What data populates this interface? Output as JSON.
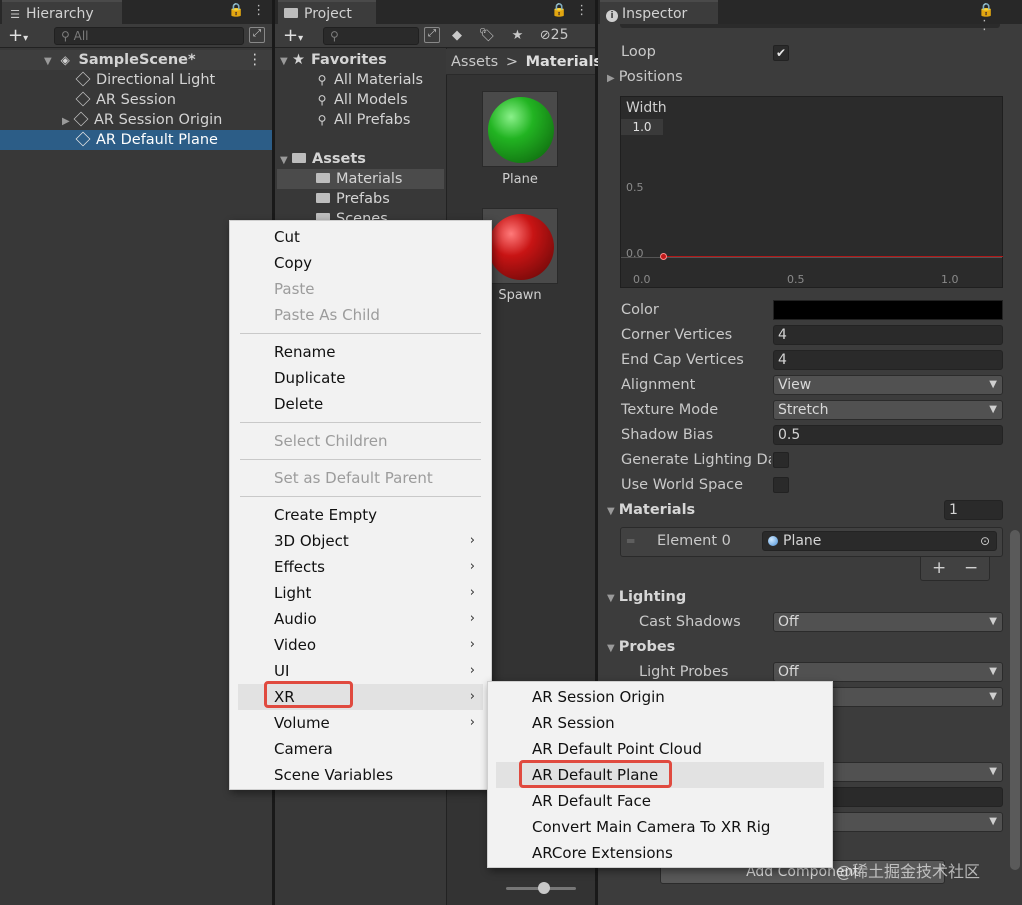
{
  "hierarchy": {
    "tab_title": "Hierarchy",
    "search_placeholder": "All",
    "scene_name": "SampleScene*",
    "items": [
      "Directional Light",
      "AR Session",
      "AR Session Origin",
      "AR Default Plane"
    ],
    "selected_index": 3
  },
  "project": {
    "tab_title": "Project",
    "badge_count": "25",
    "favorites_label": "Favorites",
    "favorites": [
      "All Materials",
      "All Models",
      "All Prefabs"
    ],
    "assets_label": "Assets",
    "folders": [
      "Materials",
      "Prefabs",
      "Scenes"
    ],
    "breadcrumb_root": "Assets",
    "breadcrumb_sep": ">",
    "breadcrumb_current": "Materials",
    "thumbs": [
      {
        "label": "Plane",
        "color": "#22b422"
      },
      {
        "label": "Spawn",
        "color": "#c81414"
      }
    ]
  },
  "inspector": {
    "tab_title": "Inspector",
    "loop_label": "Loop",
    "positions_label": "Positions",
    "width_label": "Width",
    "width_value": "1.0",
    "curve_y_ticks": [
      "0.5",
      "0.0"
    ],
    "curve_x_ticks": [
      "0.0",
      "0.5",
      "1.0"
    ],
    "props": [
      {
        "label": "Color",
        "kind": "color",
        "value": ""
      },
      {
        "label": "Corner Vertices",
        "kind": "field",
        "value": "4"
      },
      {
        "label": "End Cap Vertices",
        "kind": "field",
        "value": "4"
      },
      {
        "label": "Alignment",
        "kind": "dropdown",
        "value": "View"
      },
      {
        "label": "Texture Mode",
        "kind": "dropdown",
        "value": "Stretch"
      },
      {
        "label": "Shadow Bias",
        "kind": "field",
        "value": "0.5"
      },
      {
        "label": "Generate Lighting Da",
        "kind": "checkbox",
        "value": ""
      },
      {
        "label": "Use World Space",
        "kind": "checkbox",
        "value": ""
      }
    ],
    "materials_label": "Materials",
    "materials_count": "1",
    "element0_label": "Element 0",
    "element0_value": "Plane",
    "lighting_label": "Lighting",
    "cast_shadows_label": "Cast Shadows",
    "cast_shadows_value": "Off",
    "probes_label": "Probes",
    "light_probes_label": "Light Probes",
    "light_probes_value": "Off",
    "add_component": "Add Component"
  },
  "context_menu": {
    "groups": [
      [
        {
          "label": "Cut",
          "enabled": true
        },
        {
          "label": "Copy",
          "enabled": true
        },
        {
          "label": "Paste",
          "enabled": false
        },
        {
          "label": "Paste As Child",
          "enabled": false
        }
      ],
      [
        {
          "label": "Rename",
          "enabled": true
        },
        {
          "label": "Duplicate",
          "enabled": true
        },
        {
          "label": "Delete",
          "enabled": true
        }
      ],
      [
        {
          "label": "Select Children",
          "enabled": false
        }
      ],
      [
        {
          "label": "Set as Default Parent",
          "enabled": false
        }
      ],
      [
        {
          "label": "Create Empty",
          "enabled": true
        },
        {
          "label": "3D Object",
          "enabled": true,
          "submenu": true
        },
        {
          "label": "Effects",
          "enabled": true,
          "submenu": true
        },
        {
          "label": "Light",
          "enabled": true,
          "submenu": true
        },
        {
          "label": "Audio",
          "enabled": true,
          "submenu": true
        },
        {
          "label": "Video",
          "enabled": true,
          "submenu": true
        },
        {
          "label": "UI",
          "enabled": true,
          "submenu": true
        },
        {
          "label": "XR",
          "enabled": true,
          "submenu": true,
          "active": true
        },
        {
          "label": "Volume",
          "enabled": true,
          "submenu": true
        },
        {
          "label": "Camera",
          "enabled": true
        },
        {
          "label": "Scene Variables",
          "enabled": true
        }
      ]
    ]
  },
  "xr_submenu": {
    "items": [
      "AR Session Origin",
      "AR Session",
      "AR Default Point Cloud",
      "AR Default Plane",
      "AR Default Face",
      "Convert Main Camera To XR Rig",
      "ARCore Extensions"
    ],
    "active_index": 3
  },
  "watermark": "@稀土掘金技术社区",
  "colors": {
    "highlight": "#e04a3f",
    "selection": "#2c5d87",
    "curve": "#c01818"
  }
}
